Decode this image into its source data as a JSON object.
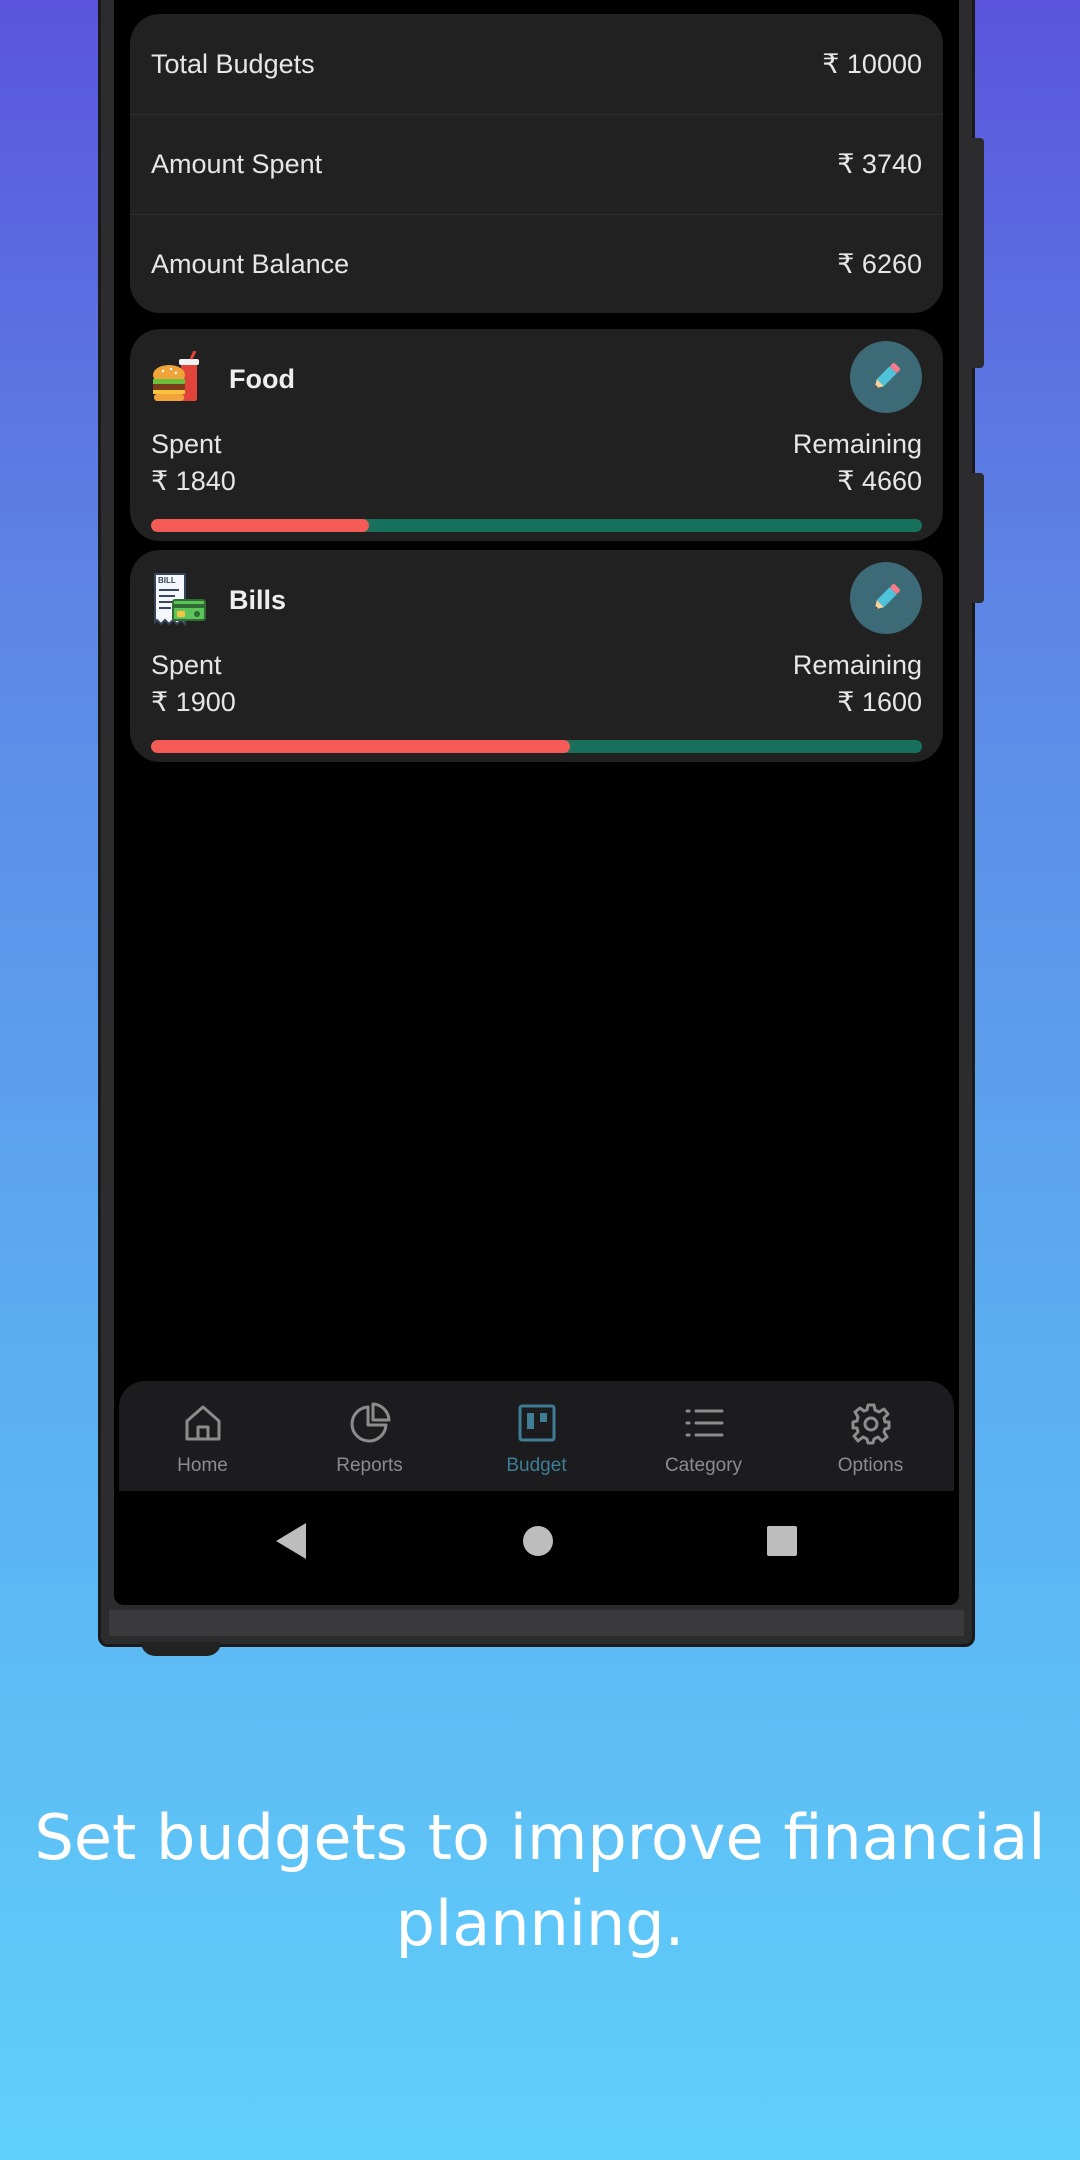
{
  "summary": {
    "rows": [
      {
        "label": "Total Budgets",
        "value": "₹ 10000"
      },
      {
        "label": "Amount Spent",
        "value": "₹ 3740"
      },
      {
        "label": "Amount Balance",
        "value": "₹ 6260"
      }
    ]
  },
  "categories": [
    {
      "name": "Food",
      "icon": "burger-drink-icon",
      "spent_label": "Spent",
      "spent": "₹ 1840",
      "remaining_label": "Remaining",
      "remaining": "₹ 4660",
      "spent_fraction": 0.283
    },
    {
      "name": "Bills",
      "icon": "bill-receipt-icon",
      "spent_label": "Spent",
      "spent": "₹ 1900",
      "remaining_label": "Remaining",
      "remaining": "₹ 1600",
      "spent_fraction": 0.543
    }
  ],
  "nav": {
    "items": [
      {
        "label": "Home",
        "icon": "home-icon"
      },
      {
        "label": "Reports",
        "icon": "pie-chart-icon"
      },
      {
        "label": "Budget",
        "icon": "budget-board-icon",
        "active": true
      },
      {
        "label": "Category",
        "icon": "list-icon"
      },
      {
        "label": "Options",
        "icon": "gear-icon"
      }
    ]
  },
  "colors": {
    "spent_bar": "#f45b57",
    "remaining_bar": "#16705c",
    "active_nav": "#3e7d96",
    "edit_button": "#3d6a77"
  },
  "tagline": "Set budgets to improve financial planning."
}
